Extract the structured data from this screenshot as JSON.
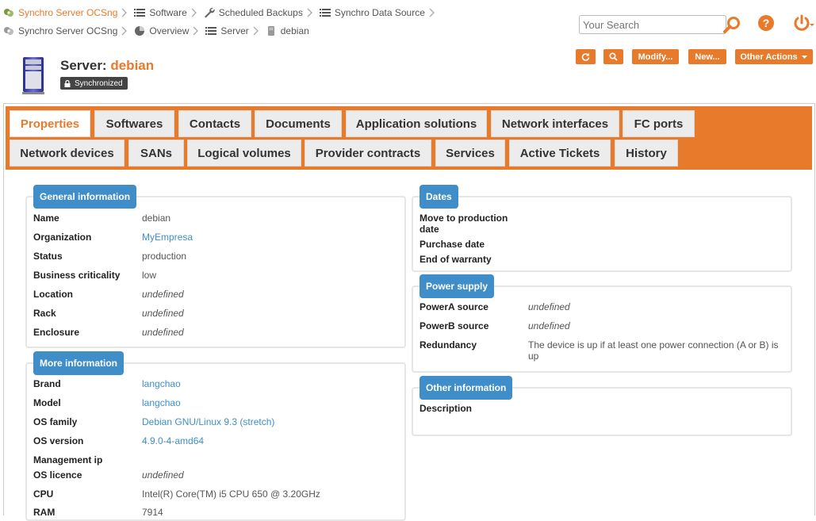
{
  "breadcrumbs": {
    "row1": [
      {
        "label": "Synchro Server OCSng",
        "icon": "synchro-icon",
        "active": true
      },
      {
        "label": "Software",
        "icon": "list-icon",
        "active": false
      },
      {
        "label": "Scheduled Backups",
        "icon": "wrench-icon",
        "active": false
      },
      {
        "label": "Synchro Data Source",
        "icon": "list-icon",
        "active": false
      }
    ],
    "row2": [
      {
        "label": "Synchro Server OCSng",
        "icon": "synchro-icon",
        "active": false
      },
      {
        "label": "Overview",
        "icon": "pie-chart-icon",
        "active": false
      },
      {
        "label": "Server",
        "icon": "list-icon",
        "active": false
      },
      {
        "label": "debian",
        "icon": "server-small-icon",
        "active": false
      }
    ]
  },
  "search": {
    "placeholder": "Your Search"
  },
  "object": {
    "class_label": "Server:",
    "name": "debian",
    "status_badge": "Synchronized"
  },
  "actions": {
    "refresh_icon": "refresh-icon",
    "search_icon": "search-icon",
    "modify": "Modify...",
    "new": "New...",
    "other": "Other Actions"
  },
  "tabs": {
    "row1": [
      "Properties",
      "Softwares",
      "Contacts",
      "Documents",
      "Application solutions",
      "Network interfaces",
      "FC ports"
    ],
    "row2": [
      "Network devices",
      "SANs",
      "Logical volumes",
      "Provider contracts",
      "Services",
      "Active Tickets",
      "History"
    ]
  },
  "general": {
    "title": "General information",
    "fields": [
      {
        "label": "Name",
        "value": "debian",
        "style": "plain"
      },
      {
        "label": "Organization",
        "value": "MyEmpresa",
        "style": "link"
      },
      {
        "label": "Status",
        "value": "production",
        "style": "plain"
      },
      {
        "label": "Business criticality",
        "value": "low",
        "style": "plain"
      },
      {
        "label": "Location",
        "value": "undefined",
        "style": "undef"
      },
      {
        "label": "Rack",
        "value": "undefined",
        "style": "undef"
      },
      {
        "label": "Enclosure",
        "value": "undefined",
        "style": "undef"
      }
    ]
  },
  "more": {
    "title": "More information",
    "fields": [
      {
        "label": "Brand",
        "value": "langchao",
        "style": "link"
      },
      {
        "label": "Model",
        "value": "langchao",
        "style": "link"
      },
      {
        "label": "OS family",
        "value": "Debian GNU/Linux 9.3 (stretch)",
        "style": "link"
      },
      {
        "label": "OS version",
        "value": "4.9.0-4-amd64",
        "style": "link"
      },
      {
        "label": "Management ip",
        "value": "",
        "style": "plain"
      },
      {
        "label": "OS licence",
        "value": "undefined",
        "style": "undef"
      },
      {
        "label": "CPU",
        "value": "Intel(R) Core(TM) i5 CPU 650 @ 3.20GHz",
        "style": "plain"
      },
      {
        "label": "RAM",
        "value": "7914",
        "style": "plain"
      }
    ]
  },
  "dates": {
    "title": "Dates",
    "fields": [
      {
        "label": "Move to production date"
      },
      {
        "label": "Purchase date"
      },
      {
        "label": "End of warranty"
      }
    ]
  },
  "power": {
    "title": "Power supply",
    "fields": [
      {
        "label": "PowerA source",
        "value": "undefined",
        "style": "undef"
      },
      {
        "label": "PowerB source",
        "value": "undefined",
        "style": "undef"
      },
      {
        "label": "Redundancy",
        "value": "The device is up if at least one power connection (A or B) is up",
        "style": "plain"
      }
    ]
  },
  "other": {
    "title": "Other information",
    "fields": [
      {
        "label": "Description",
        "value": ""
      }
    ]
  },
  "colors": {
    "accent": "#e87a2c",
    "legend": "#3f8ec9",
    "link": "#3f8ec9"
  }
}
